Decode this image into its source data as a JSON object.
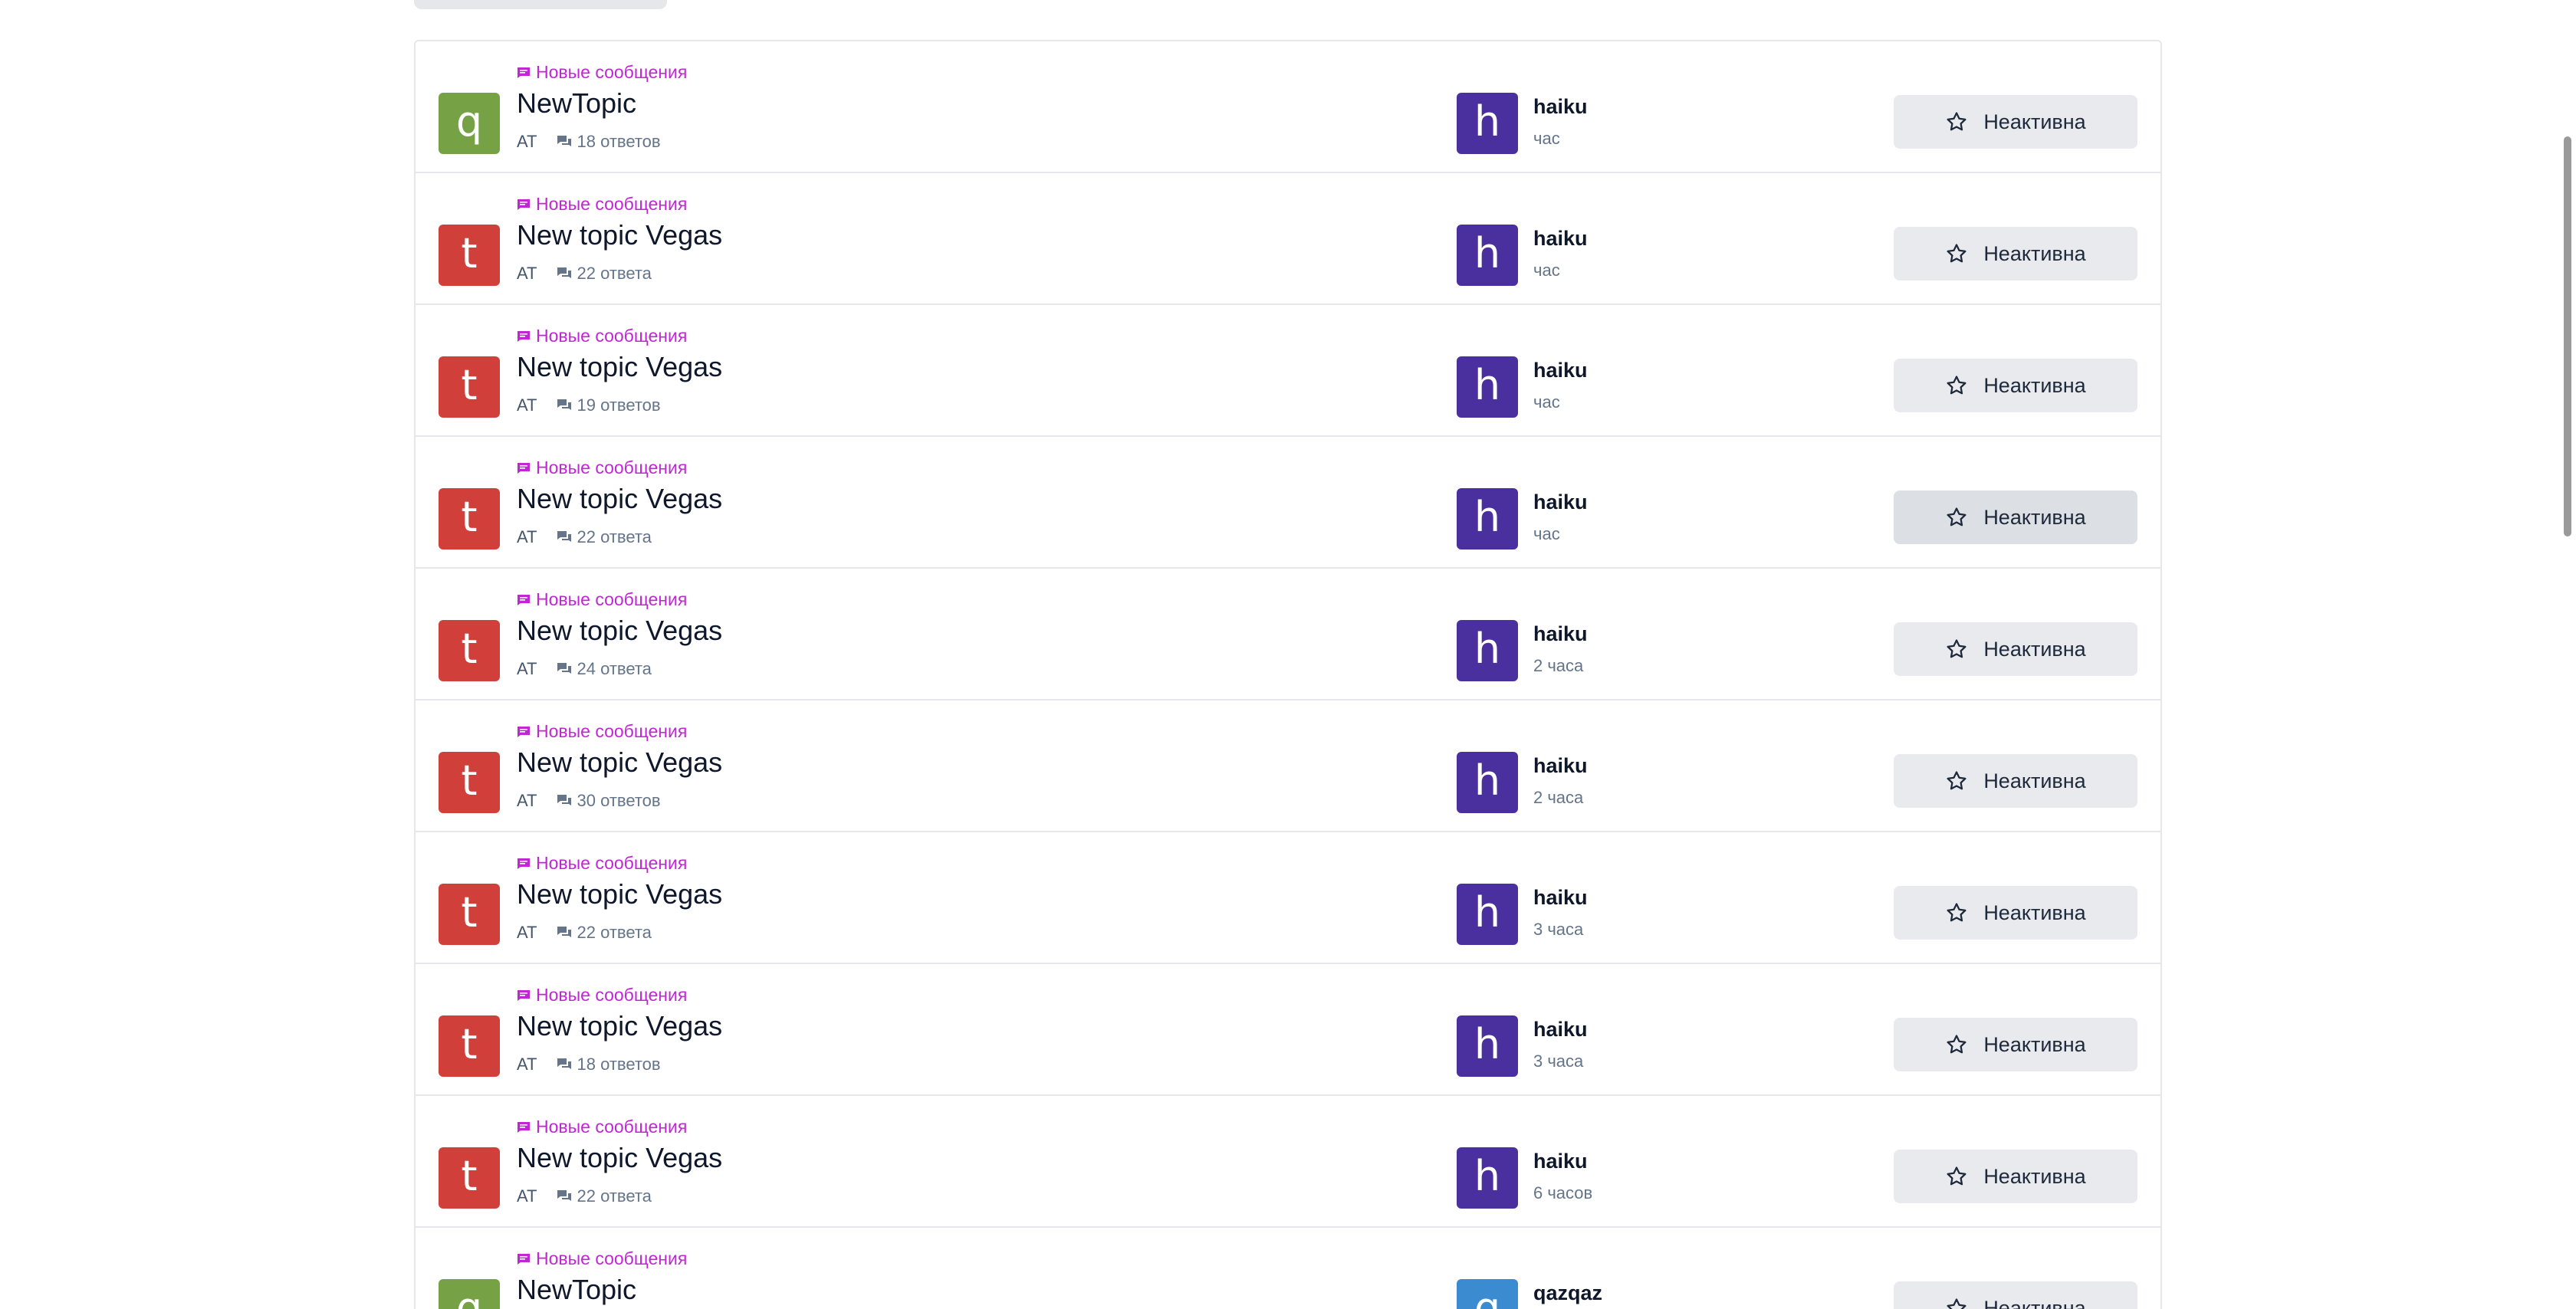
{
  "colors": {
    "avatar_q": "#76a145",
    "avatar_t": "#d13f3a",
    "avatar_h": "#4a2f9e",
    "avatar_qazqaz": "#3a8bd0",
    "badge_text": "#c026d3",
    "button_bg": "#e8eaee"
  },
  "topics": [
    {
      "badge": "Новые сообщения",
      "avatar_letter": "q",
      "avatar_color": "q",
      "title": "NewTopic",
      "category": "AT",
      "replies": "18 ответов",
      "last_letter": "h",
      "last_color": "h",
      "last_user": "haiku",
      "last_time": "час",
      "subscribe": "Неактивна"
    },
    {
      "badge": "Новые сообщения",
      "avatar_letter": "t",
      "avatar_color": "t",
      "title": "New topic Vegas",
      "category": "AT",
      "replies": "22 ответа",
      "last_letter": "h",
      "last_color": "h",
      "last_user": "haiku",
      "last_time": "час",
      "subscribe": "Неактивна"
    },
    {
      "badge": "Новые сообщения",
      "avatar_letter": "t",
      "avatar_color": "t",
      "title": "New topic Vegas",
      "category": "AT",
      "replies": "19 ответов",
      "last_letter": "h",
      "last_color": "h",
      "last_user": "haiku",
      "last_time": "час",
      "subscribe": "Неактивна"
    },
    {
      "badge": "Новые сообщения",
      "avatar_letter": "t",
      "avatar_color": "t",
      "title": "New topic Vegas",
      "category": "AT",
      "replies": "22 ответа",
      "last_letter": "h",
      "last_color": "h",
      "last_user": "haiku",
      "last_time": "час",
      "subscribe": "Неактивна",
      "hovered": true
    },
    {
      "badge": "Новые сообщения",
      "avatar_letter": "t",
      "avatar_color": "t",
      "title": "New topic Vegas",
      "category": "AT",
      "replies": "24 ответа",
      "last_letter": "h",
      "last_color": "h",
      "last_user": "haiku",
      "last_time": "2 часа",
      "subscribe": "Неактивна"
    },
    {
      "badge": "Новые сообщения",
      "avatar_letter": "t",
      "avatar_color": "t",
      "title": "New topic Vegas",
      "category": "AT",
      "replies": "30 ответов",
      "last_letter": "h",
      "last_color": "h",
      "last_user": "haiku",
      "last_time": "2 часа",
      "subscribe": "Неактивна"
    },
    {
      "badge": "Новые сообщения",
      "avatar_letter": "t",
      "avatar_color": "t",
      "title": "New topic Vegas",
      "category": "AT",
      "replies": "22 ответа",
      "last_letter": "h",
      "last_color": "h",
      "last_user": "haiku",
      "last_time": "3 часа",
      "subscribe": "Неактивна"
    },
    {
      "badge": "Новые сообщения",
      "avatar_letter": "t",
      "avatar_color": "t",
      "title": "New topic Vegas",
      "category": "AT",
      "replies": "18 ответов",
      "last_letter": "h",
      "last_color": "h",
      "last_user": "haiku",
      "last_time": "3 часа",
      "subscribe": "Неактивна"
    },
    {
      "badge": "Новые сообщения",
      "avatar_letter": "t",
      "avatar_color": "t",
      "title": "New topic Vegas",
      "category": "AT",
      "replies": "22 ответа",
      "last_letter": "h",
      "last_color": "h",
      "last_user": "haiku",
      "last_time": "6 часов",
      "subscribe": "Неактивна"
    },
    {
      "badge": "Новые сообщения",
      "avatar_letter": "q",
      "avatar_color": "q",
      "title": "NewTopic",
      "category": "",
      "replies": "",
      "last_letter": "q",
      "last_color": "qazqaz",
      "last_user": "qazqaz",
      "last_time": "",
      "subscribe": "Неактивна"
    }
  ]
}
